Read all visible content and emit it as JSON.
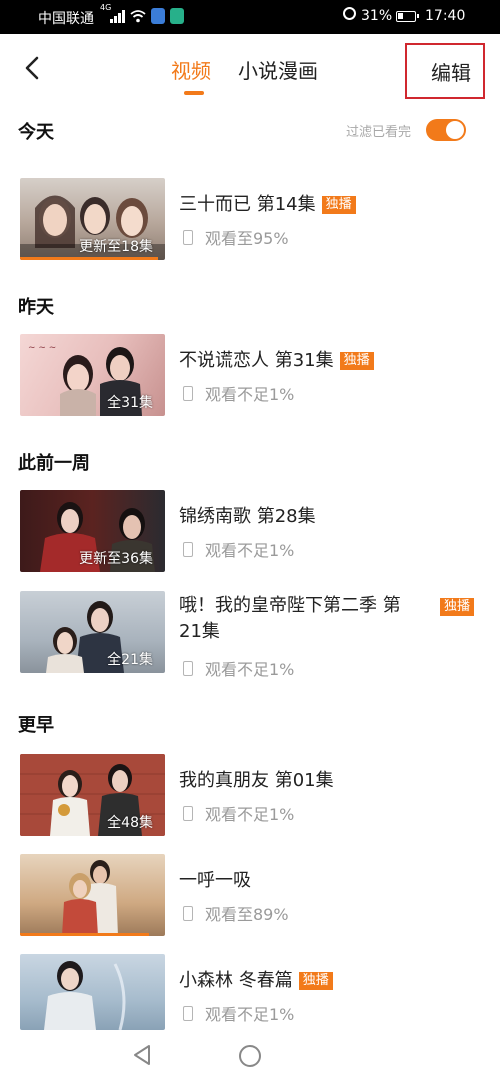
{
  "status_bar": {
    "carrier": "中国联通",
    "network": "4G",
    "battery_pct": "31%",
    "time": "17:40"
  },
  "header": {
    "tabs": [
      {
        "label": "视频",
        "active": true
      },
      {
        "label": "小说漫画",
        "active": false
      }
    ],
    "edit_label": "编辑"
  },
  "filter": {
    "label": "过滤已看完",
    "on": true
  },
  "accent_color": "#f27a1a",
  "sections": [
    {
      "label": "今天"
    },
    {
      "label": "昨天"
    },
    {
      "label": "此前一周"
    },
    {
      "label": "更早"
    }
  ],
  "items": [
    {
      "title": "三十而已 第14集",
      "badge": "独播",
      "thumb_caption": "更新至18集",
      "watch_status": "观看至95%",
      "progress": 0.95
    },
    {
      "title": "不说谎恋人 第31集",
      "badge": "独播",
      "thumb_caption": "全31集",
      "watch_status": "观看不足1%",
      "progress": 0.01
    },
    {
      "title": "锦绣南歌 第28集",
      "badge": "",
      "thumb_caption": "更新至36集",
      "watch_status": "观看不足1%",
      "progress": 0.01
    },
    {
      "title": "哦！我的皇帝陛下第二季 第",
      "title_line2": "21集",
      "badge": "独播",
      "thumb_caption": "全21集",
      "watch_status": "观看不足1%",
      "progress": 0.01
    },
    {
      "title": "我的真朋友 第01集",
      "badge": "",
      "thumb_caption": "全48集",
      "watch_status": "观看不足1%",
      "progress": 0.01
    },
    {
      "title": "一呼一吸",
      "badge": "",
      "thumb_caption": "",
      "watch_status": "观看至89%",
      "progress": 0.89
    },
    {
      "title": "小森林 冬春篇",
      "badge": "独播",
      "thumb_caption": "",
      "watch_status": "观看不足1%",
      "progress": 0.01
    }
  ]
}
